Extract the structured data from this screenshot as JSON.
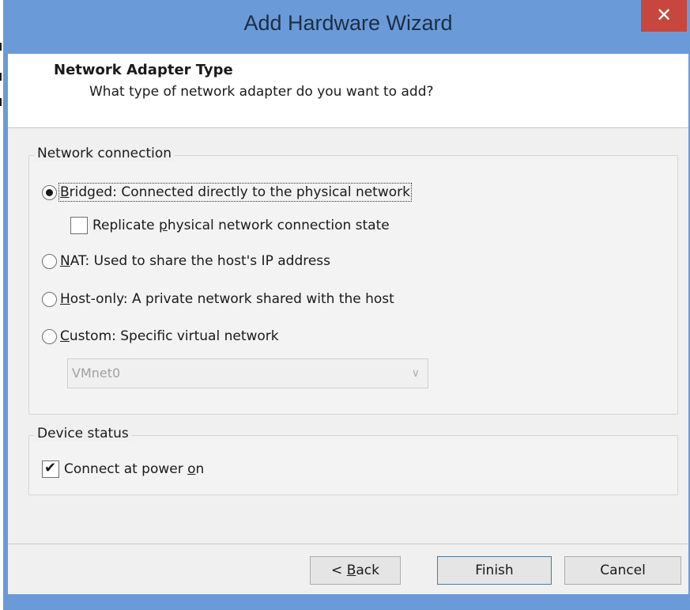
{
  "window": {
    "title": "Add Hardware Wizard",
    "close_glyph": "✕"
  },
  "header": {
    "title": "Network Adapter Type",
    "subtitle": "What type of network adapter do you want to add?"
  },
  "network_connection": {
    "legend": "Network connection",
    "options": [
      {
        "pre": "",
        "key": "B",
        "post": "ridged: Connected directly to the physical network",
        "selected": true
      },
      {
        "pre": "",
        "key": "N",
        "post": "AT: Used to share the host's IP address",
        "selected": false
      },
      {
        "pre": "",
        "key": "H",
        "post": "ost-only: A private network shared with the host",
        "selected": false
      },
      {
        "pre": "",
        "key": "C",
        "post": "ustom: Specific virtual network",
        "selected": false
      }
    ],
    "replicate": {
      "pre": "Replicate ",
      "key": "p",
      "post": "hysical network connection state",
      "checked": false
    },
    "custom_network": {
      "value": "VMnet0",
      "enabled": false
    }
  },
  "device_status": {
    "legend": "Device status",
    "connect_at_power_on": {
      "pre": "Connect at power ",
      "key": "o",
      "post": "n",
      "checked": true
    }
  },
  "buttons": {
    "back": {
      "pre": "< ",
      "key": "B",
      "post": "ack"
    },
    "finish": "Finish",
    "cancel": "Cancel"
  }
}
